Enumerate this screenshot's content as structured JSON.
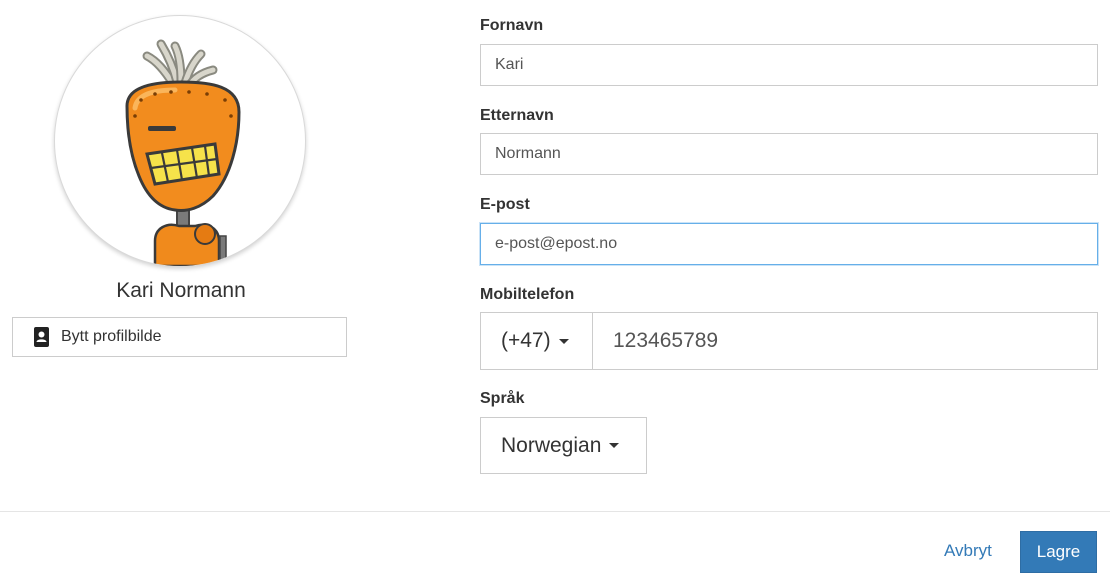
{
  "profile": {
    "name": "Kari Normann",
    "change_photo_label": "Bytt profilbilde",
    "avatar_icon": "robot-avatar",
    "change_photo_icon": "contact-card-icon"
  },
  "form": {
    "first_name": {
      "label": "Fornavn",
      "value": "Kari"
    },
    "last_name": {
      "label": "Etternavn",
      "value": "Normann"
    },
    "email": {
      "label": "E-post",
      "value": "e-post@epost.no"
    },
    "mobile": {
      "label": "Mobiltelefon",
      "country_code": "(+47)",
      "value": "123465789"
    },
    "language": {
      "label": "Språk",
      "selected": "Norwegian"
    }
  },
  "actions": {
    "cancel_label": "Avbryt",
    "save_label": "Lagre"
  },
  "colors": {
    "primary": "#337ab7",
    "focus_border": "#66afe9",
    "avatar_orange": "#f08a1c"
  }
}
